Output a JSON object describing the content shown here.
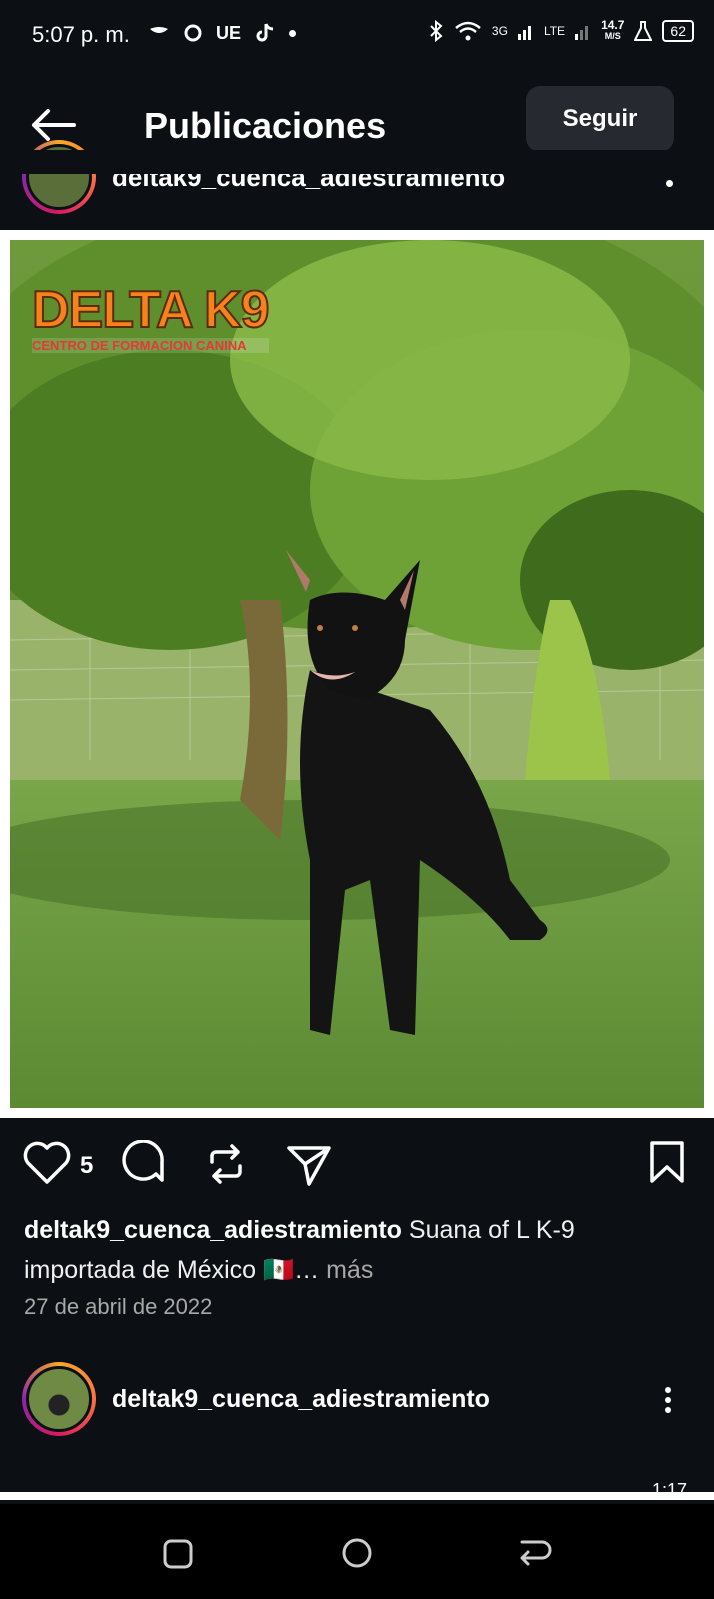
{
  "status_bar": {
    "time": "5:07 p. m.",
    "carrier_label": "UE",
    "network_3g": "3G",
    "network_lte": "LTE",
    "speed": "14.7",
    "speed_unit": "M/S",
    "battery": "62"
  },
  "header": {
    "title": "Publicaciones",
    "follow_label": "Seguir"
  },
  "previous_post": {
    "username": "deltak9_cuenca_adiestramiento"
  },
  "post": {
    "image_logo_text": "DELTA K9",
    "image_logo_subtitle": "CENTRO DE FORMACION CANINA",
    "like_count": "5",
    "caption_user": "deltak9_cuenca_adiestramiento",
    "caption_text": "Suana of L K-9 importada de México 🇲🇽…",
    "caption_more": "más",
    "date": "27 de abril de 2022"
  },
  "next_post": {
    "username": "deltak9_cuenca_adiestramiento",
    "video_time": "1:17"
  },
  "colors": {
    "background": "#0c1014",
    "follow_button": "#262a30",
    "muted_text": "#a8a8a8"
  }
}
